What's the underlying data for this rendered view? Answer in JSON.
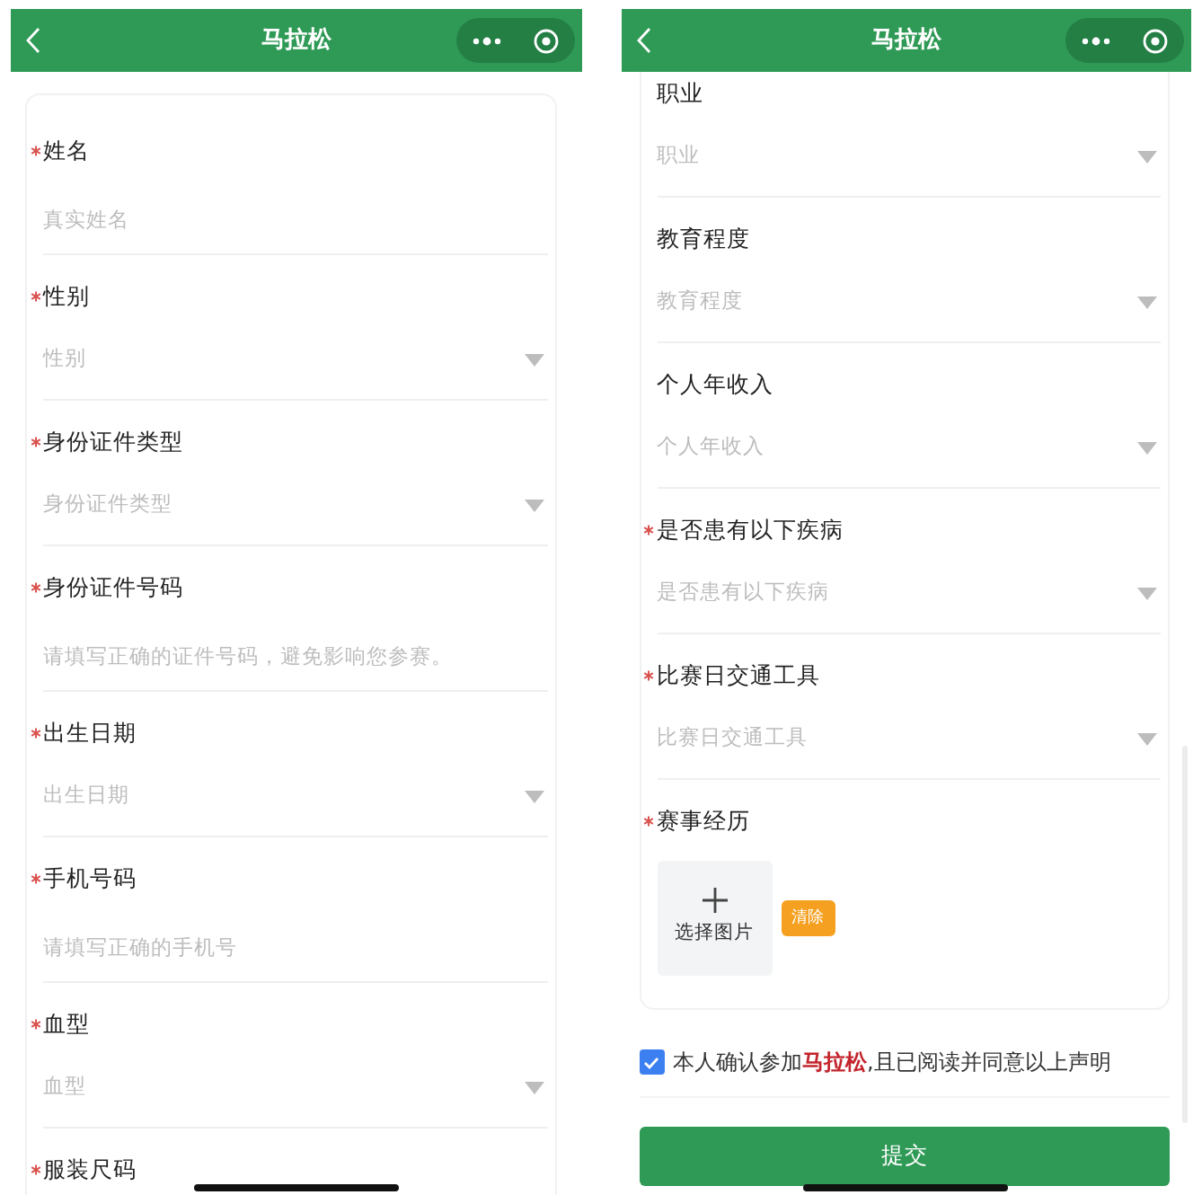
{
  "phones": [
    {
      "title": "马拉松",
      "fields": [
        {
          "label": "姓名",
          "required": true,
          "kind": "text",
          "placeholder": "真实姓名"
        },
        {
          "label": "性别",
          "required": true,
          "kind": "select",
          "placeholder": "性别"
        },
        {
          "label": "身份证件类型",
          "required": true,
          "kind": "select",
          "placeholder": "身份证件类型"
        },
        {
          "label": "身份证件号码",
          "required": true,
          "kind": "text",
          "placeholder": "请填写正确的证件号码，避免影响您参赛。"
        },
        {
          "label": "出生日期",
          "required": true,
          "kind": "select",
          "placeholder": "出生日期"
        },
        {
          "label": "手机号码",
          "required": true,
          "kind": "text",
          "placeholder": "请填写正确的手机号"
        },
        {
          "label": "血型",
          "required": true,
          "kind": "select",
          "placeholder": "血型"
        },
        {
          "label": "服装尺码",
          "required": true
        }
      ]
    },
    {
      "title": "马拉松",
      "fields": [
        {
          "label": "职业",
          "required": false,
          "kind": "select",
          "placeholder": "职业"
        },
        {
          "label": "教育程度",
          "required": false,
          "kind": "select",
          "placeholder": "教育程度"
        },
        {
          "label": "个人年收入",
          "required": false,
          "kind": "select",
          "placeholder": "个人年收入"
        },
        {
          "label": "是否患有以下疾病",
          "required": true,
          "kind": "select",
          "placeholder": "是否患有以下疾病"
        },
        {
          "label": "比赛日交通工具",
          "required": true,
          "kind": "select",
          "placeholder": "比赛日交通工具"
        },
        {
          "label": "赛事经历",
          "required": true,
          "kind": "upload",
          "upload_label": "选择图片",
          "clear_button": "清除"
        }
      ],
      "agreement": {
        "checked": true,
        "text": "本人确认参加**马拉松**,且已阅读并同意以上声明"
      },
      "submit_button": "提交"
    }
  ]
}
